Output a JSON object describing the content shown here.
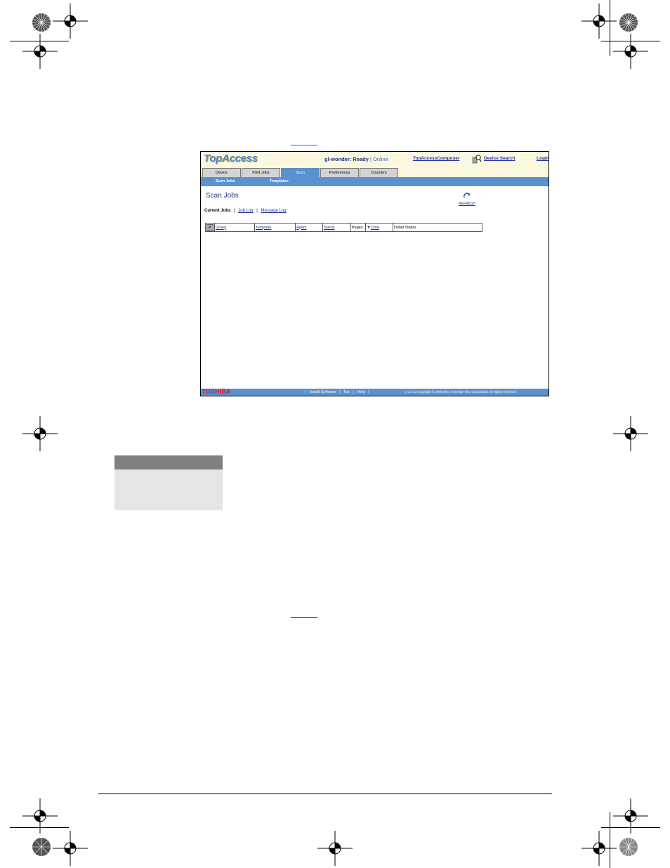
{
  "app": {
    "logo": "TopAccess",
    "device_status": "gl-wonder: Ready",
    "status_separator": "|",
    "online": "Online",
    "links": {
      "composer": "TopAccessComposer",
      "device_search": "Device Search",
      "login": "Login"
    }
  },
  "tabs": [
    {
      "label": "Device"
    },
    {
      "label": "Print Jobs"
    },
    {
      "label": "Scan"
    },
    {
      "label": "Preferences"
    },
    {
      "label": "Counters"
    }
  ],
  "active_tab": "Scan",
  "subnav": [
    {
      "label": "Scan Jobs"
    },
    {
      "label": "Templates"
    }
  ],
  "page": {
    "title": "Scan Jobs",
    "refresh_label": "REFRESH",
    "views": {
      "current": "Current Jobs",
      "job_log": "Job Log",
      "message_log": "Message Log",
      "separator": "|"
    }
  },
  "table": {
    "check_icon": "checkmark-icon",
    "columns": [
      "Group",
      "Template",
      "Agent",
      "Status",
      "Pages",
      "Time",
      "Detail Status"
    ],
    "sort_indicator": "sort-down-arrow-icon"
  },
  "footer": {
    "brand": "TOSHIBA",
    "links": [
      "Install Software",
      "Top",
      "Help"
    ],
    "separator": "|",
    "copyright": "V 1.2.4.2    Copyright © 1999-2001 TOSHIBA TEC Corporation. All Rights Reserved"
  },
  "colors": {
    "accent_blue": "#5a92d0",
    "header_cream": "#fbf8df",
    "brand_red": "#e8102a",
    "link_blue": "#1a2f9c"
  }
}
